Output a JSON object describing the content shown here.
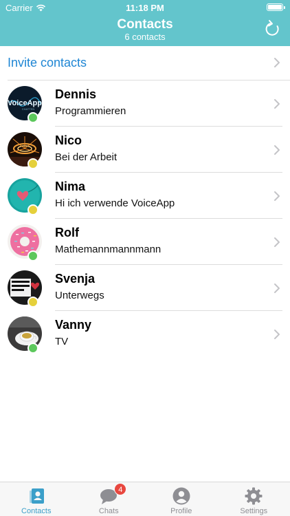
{
  "status_bar": {
    "carrier": "Carrier",
    "time": "11:18 PM"
  },
  "nav": {
    "title": "Contacts",
    "subtitle": "6 contacts"
  },
  "invite": {
    "label": "Invite contacts"
  },
  "contacts": [
    {
      "name": "Dennis",
      "status": "Programmieren",
      "presence_color": "#5cc85c"
    },
    {
      "name": "Nico",
      "status": "Bei der Arbeit",
      "presence_color": "#e5d03b"
    },
    {
      "name": "Nima",
      "status": "Hi ich verwende VoiceApp",
      "presence_color": "#e5d03b"
    },
    {
      "name": "Rolf",
      "status": "Mathemannmannmann",
      "presence_color": "#5cc85c"
    },
    {
      "name": "Svenja",
      "status": "Unterwegs",
      "presence_color": "#e5d03b"
    },
    {
      "name": "Vanny",
      "status": "TV",
      "presence_color": "#5cc85c"
    }
  ],
  "tabs": [
    {
      "label": "Contacts",
      "icon": "contacts-icon",
      "active": true
    },
    {
      "label": "Chats",
      "icon": "chat-bubble-icon",
      "badge": "4"
    },
    {
      "label": "Profile",
      "icon": "person-icon"
    },
    {
      "label": "Settings",
      "icon": "gear-icon"
    }
  ],
  "colors": {
    "header": "#63c5cc",
    "accent": "#3b9fc9",
    "link": "#1f86d4",
    "badge": "#e8473f"
  }
}
